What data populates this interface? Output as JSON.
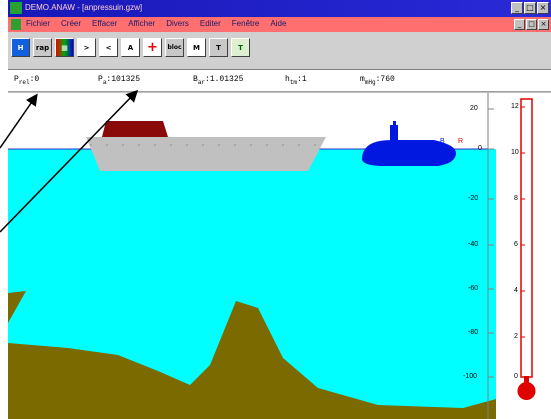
{
  "window": {
    "title": "DEMO.ANAW - [anpressuin.gzw]",
    "controls": [
      "_",
      "□",
      "×"
    ]
  },
  "menu": {
    "items": [
      "Fichier",
      "Créer",
      "Effacer",
      "Afficher",
      "Divers",
      "Editer",
      "Fenêtre",
      "Aide"
    ],
    "mdi_controls": [
      "_",
      "□",
      "×"
    ]
  },
  "toolbar": {
    "tools": [
      {
        "label": "H",
        "icon": "arrow-h-icon"
      },
      {
        "label": "rap",
        "icon": "report-icon"
      },
      {
        "label": "▦",
        "icon": "palette-icon"
      },
      {
        "label": ">",
        "icon": "next-icon"
      },
      {
        "label": "<",
        "icon": "previous-icon"
      },
      {
        "label": "A",
        "icon": "text-icon"
      },
      {
        "label": "+",
        "icon": "crosshair-icon"
      },
      {
        "label": "bloc",
        "icon": "block-icon"
      },
      {
        "label": "M",
        "icon": "measure-icon"
      },
      {
        "label": "T",
        "icon": "tool-icon"
      },
      {
        "label": "T",
        "icon": "template-icon"
      }
    ]
  },
  "params": [
    {
      "symbol": "P",
      "sub": "rel",
      "value": ":0"
    },
    {
      "symbol": "P",
      "sub": "a",
      "value": ":101325"
    },
    {
      "symbol": "B",
      "sub": "ar",
      "value": ":1.01325"
    },
    {
      "symbol": "h",
      "sub": "tm",
      "value": ":1"
    },
    {
      "symbol": "m",
      "sub": "mHg",
      "value": ":760"
    }
  ],
  "depth_scale": [
    "20",
    "0",
    "-20",
    "-40",
    "-60",
    "-80",
    "-100"
  ],
  "thermometer_scale": [
    "12",
    "10",
    "8",
    "6",
    "4",
    "2",
    "0"
  ],
  "submarine_labels": [
    "B",
    "R"
  ],
  "colors": {
    "water": "#00ffff",
    "seabed": "#7a6a00",
    "boat_hull": "#c0c0c0",
    "boat_cabin": "#8a0a0a",
    "submarine": "#0018e0",
    "thermometer": "#ff0000",
    "menubar": "#ff6f6f",
    "titlebar": "#1818b8"
  }
}
